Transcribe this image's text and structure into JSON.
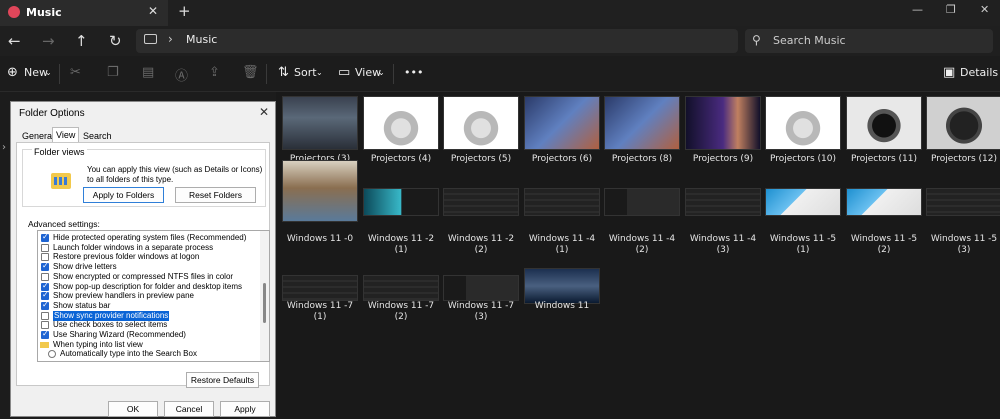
{
  "window": {
    "tab_title": "Music",
    "tab_close": "✕",
    "new_tab": "+",
    "minimize": "—",
    "maximize": "❐",
    "close": "✕"
  },
  "nav": {
    "back": "←",
    "forward": "→",
    "up": "↑",
    "refresh": "↻",
    "chevron": "›",
    "path": "Music",
    "search_placeholder": "Search Music"
  },
  "toolbar": {
    "new": "New",
    "sort": "Sort",
    "view": "View",
    "more": "•••",
    "details": "Details"
  },
  "files": [
    {
      "label": "Projectors (3)",
      "thumb": "t-conf"
    },
    {
      "label": "Projectors (4)",
      "thumb": "t-white"
    },
    {
      "label": "Projectors (5)",
      "thumb": "t-white"
    },
    {
      "label": "Projectors (6)",
      "thumb": "t-blue"
    },
    {
      "label": "Projectors (8)",
      "thumb": "t-blue"
    },
    {
      "label": "Projectors (9)",
      "thumb": "t-purple"
    },
    {
      "label": "Projectors (10)",
      "thumb": "t-white"
    },
    {
      "label": "Projectors (11)",
      "thumb": "t-black"
    },
    {
      "label": "Projectors (12)",
      "thumb": "t-dark2"
    },
    {
      "label": "Windows 11 -0",
      "thumb": "t-person"
    },
    {
      "label": "Windows 11 -2 (1)",
      "thumb": "t-cyan"
    },
    {
      "label": "Windows 11 -2 (2)",
      "thumb": "t-screen"
    },
    {
      "label": "Windows 11 -4 (1)",
      "thumb": "t-screen"
    },
    {
      "label": "Windows 11 -4 (2)",
      "thumb": "t-screen2"
    },
    {
      "label": "Windows 11 -4 (3)",
      "thumb": "t-screen"
    },
    {
      "label": "Windows 11 -5 (1)",
      "thumb": "t-win"
    },
    {
      "label": "Windows 11 -5 (2)",
      "thumb": "t-win"
    },
    {
      "label": "Windows 11 -5 (3)",
      "thumb": "t-screen"
    },
    {
      "label": "Windows 11 -7 (1)",
      "thumb": "t-screen"
    },
    {
      "label": "Windows 11 -7 (2)",
      "thumb": "t-screen"
    },
    {
      "label": "Windows 11 -7 (3)",
      "thumb": "t-screen2"
    },
    {
      "label": "Windows 11",
      "thumb": "t-person2"
    }
  ],
  "dialog": {
    "title": "Folder Options",
    "close": "✕",
    "tabs": [
      "General",
      "View",
      "Search"
    ],
    "folder_views_label": "Folder views",
    "folder_views_text": "You can apply this view (such as Details or Icons) to all folders of this type.",
    "apply_to_folders": "Apply to Folders",
    "reset_folders": "Reset Folders",
    "advanced_label": "Advanced settings:",
    "settings": [
      {
        "text": "Hide protected operating system files (Recommended)",
        "kind": "checkbox",
        "checked": true
      },
      {
        "text": "Launch folder windows in a separate process",
        "kind": "checkbox",
        "checked": false
      },
      {
        "text": "Restore previous folder windows at logon",
        "kind": "checkbox",
        "checked": false
      },
      {
        "text": "Show drive letters",
        "kind": "checkbox",
        "checked": true
      },
      {
        "text": "Show encrypted or compressed NTFS files in color",
        "kind": "checkbox",
        "checked": false
      },
      {
        "text": "Show pop-up description for folder and desktop items",
        "kind": "checkbox",
        "checked": true
      },
      {
        "text": "Show preview handlers in preview pane",
        "kind": "checkbox",
        "checked": true
      },
      {
        "text": "Show status bar",
        "kind": "checkbox",
        "checked": true
      },
      {
        "text": "Show sync provider notifications",
        "kind": "checkbox",
        "checked": false,
        "selected": true
      },
      {
        "text": "Use check boxes to select items",
        "kind": "checkbox",
        "checked": false
      },
      {
        "text": "Use Sharing Wizard (Recommended)",
        "kind": "checkbox",
        "checked": true
      },
      {
        "text": "When typing into list view",
        "kind": "folder",
        "checked": false
      },
      {
        "text": "Automatically type into the Search Box",
        "kind": "radio",
        "checked": false
      }
    ],
    "restore_defaults": "Restore Defaults",
    "ok": "OK",
    "cancel": "Cancel",
    "apply": "Apply"
  }
}
